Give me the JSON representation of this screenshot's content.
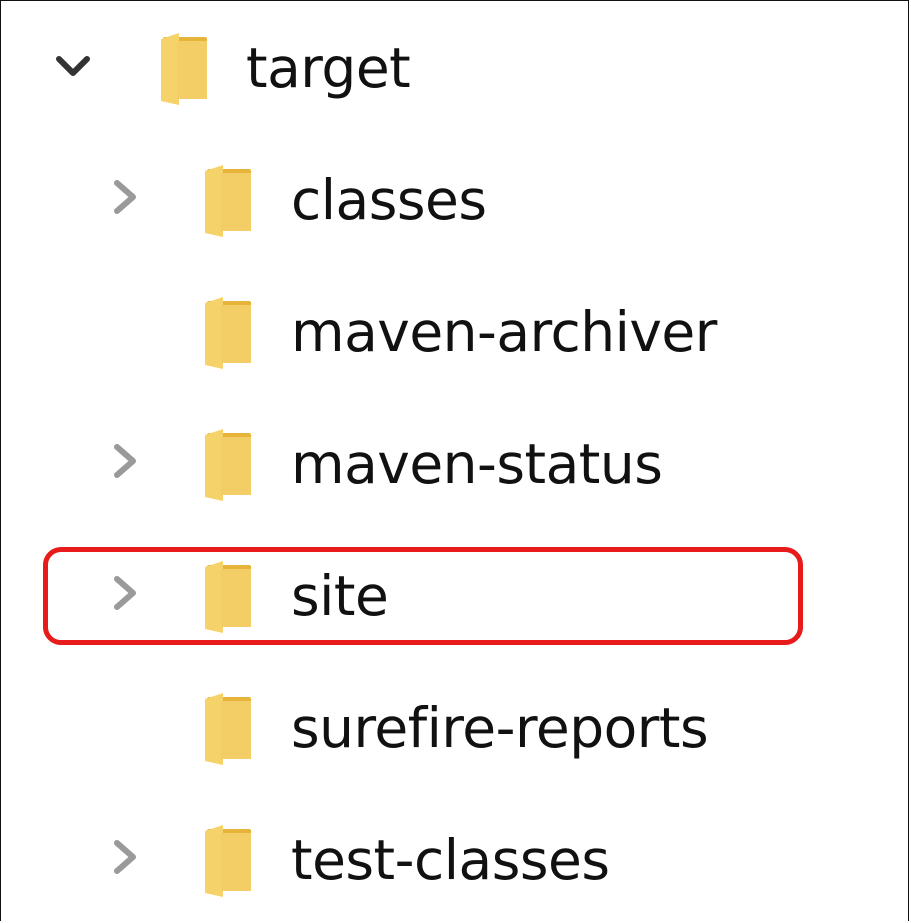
{
  "tree": {
    "root": {
      "label": "target",
      "expanded": true
    },
    "items": [
      {
        "label": "classes",
        "has_children": true
      },
      {
        "label": "maven-archiver",
        "has_children": false
      },
      {
        "label": "maven-status",
        "has_children": true
      },
      {
        "label": "site",
        "has_children": true,
        "highlighted": true
      },
      {
        "label": "surefire-reports",
        "has_children": false
      },
      {
        "label": "test-classes",
        "has_children": true
      }
    ]
  },
  "colors": {
    "folder_front": "#F6D36A",
    "folder_back": "#E7B43A",
    "chevron_collapsed": "#9a9a9a",
    "chevron_expanded": "#333333",
    "highlight": "#E81B1B"
  }
}
